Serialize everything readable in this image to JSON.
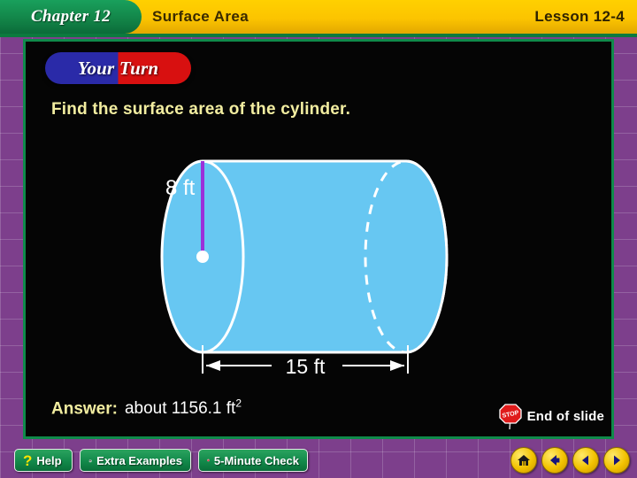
{
  "header": {
    "chapter": "Chapter 12",
    "unit_title": "Surface Area",
    "lesson": "Lesson 12-4"
  },
  "content": {
    "badge": "Your Turn",
    "question": "Find the surface area of the cylinder.",
    "answer_label": "Answer:",
    "answer_value": "about 1156.1 ft",
    "answer_exponent": "2",
    "end_of_slide": "End of slide"
  },
  "figure": {
    "shape": "cylinder",
    "radius_label": "8 ft",
    "length_label": "15 ft",
    "fill_color": "#67C7F2",
    "outline_color": "#ffffff",
    "radius_line_color": "#9B30D9",
    "hidden_edge_style": "dashed"
  },
  "toolbar": {
    "help_label": "Help",
    "help_icon": "question-mark-icon",
    "extra_examples_label": "Extra Examples",
    "extra_examples_icon": "coffee-cup-icon",
    "five_minute_check_label": "5-Minute Check",
    "five_minute_check_icon": "clock-icon"
  },
  "nav": {
    "home_icon": "home-icon",
    "back_icon": "back-arrow-icon",
    "previous_icon": "previous-arrow-icon",
    "next_icon": "next-arrow-icon"
  },
  "colors": {
    "header_yellow": "#fcc400",
    "chapter_green": "#128347",
    "border_purple": "#7b3f8a",
    "frame_green": "#0f8a4a",
    "question_yellow": "#f2eda0"
  }
}
